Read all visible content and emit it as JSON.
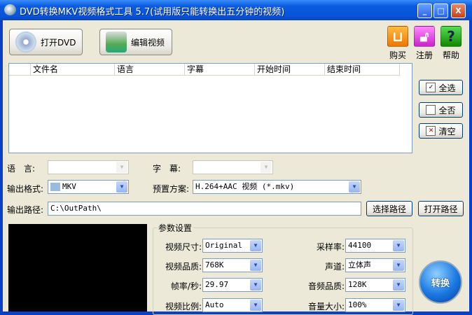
{
  "window": {
    "title": "DVD转换MKV视频格式工具 5.7(试用版只能转换出五分钟的视频)",
    "min": "_",
    "max": "□",
    "close": "X"
  },
  "toolbar": {
    "open_dvd": "打开DVD",
    "edit_video": "编辑视频",
    "buy": "购买",
    "register": "注册",
    "help": "帮助"
  },
  "list": {
    "columns": [
      "文件名",
      "语言",
      "字幕",
      "开始时间",
      "结束时间"
    ]
  },
  "side_buttons": {
    "select_all": "全选",
    "select_none": "全否",
    "clear": "清空"
  },
  "form": {
    "language_label": "语　言:",
    "language_value": "",
    "subtitle_label": "字　幕:",
    "subtitle_value": "",
    "format_label": "输出格式:",
    "format_value": "MKV",
    "preset_label": "预置方案:",
    "preset_value": "H.264+AAC 视频 (*.mkv)",
    "path_label": "输出路径:",
    "path_value": "C:\\OutPath\\",
    "choose_path": "选择路径",
    "open_path": "打开路径"
  },
  "params": {
    "title": "参数设置",
    "left": [
      {
        "label": "视频尺寸:",
        "value": "Original"
      },
      {
        "label": "视频品质:",
        "value": "768K"
      },
      {
        "label": "帧率/秒:",
        "value": "29.97"
      },
      {
        "label": "视频比例:",
        "value": "Auto"
      }
    ],
    "right": [
      {
        "label": "采样率:",
        "value": "44100"
      },
      {
        "label": "声道:",
        "value": "立体声"
      },
      {
        "label": "音频品质:",
        "value": "128K"
      },
      {
        "label": "音量大小:",
        "value": "100%"
      }
    ]
  },
  "convert": "转换"
}
